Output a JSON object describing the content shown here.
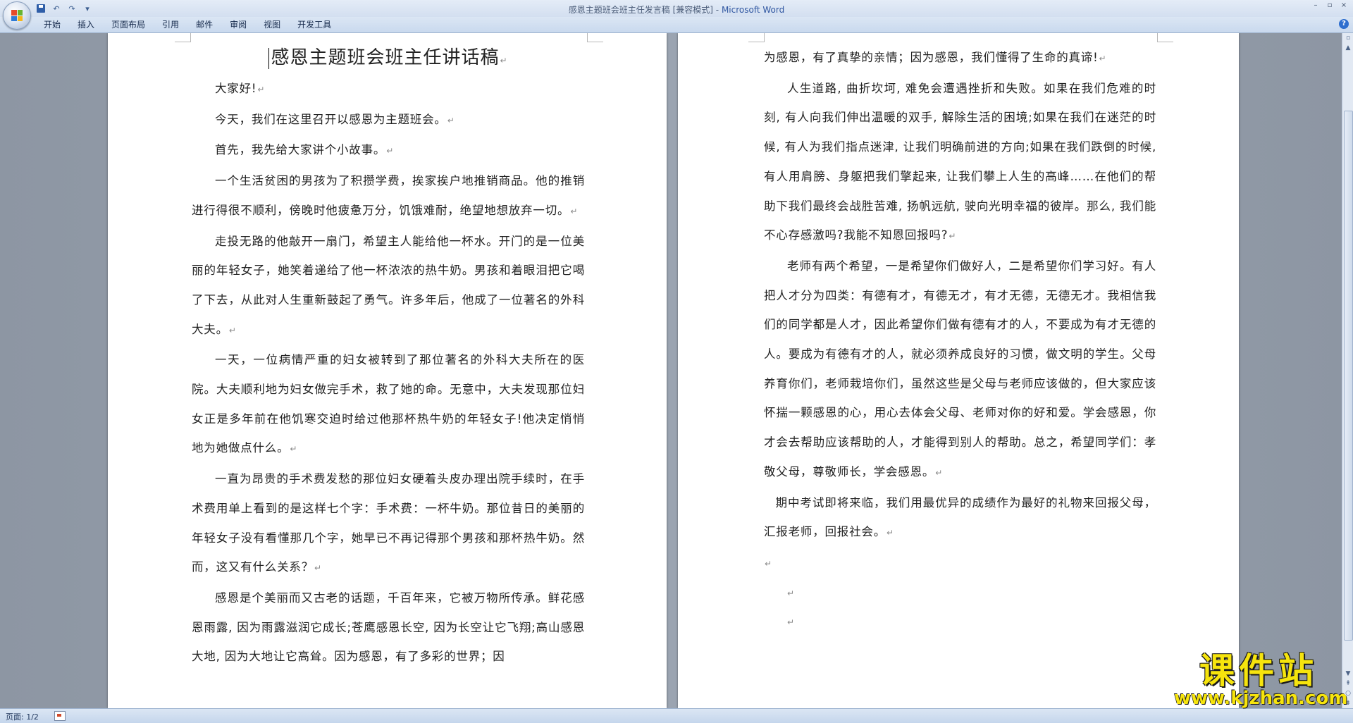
{
  "app": {
    "title_doc": "感恩主题班会班主任发言稿 [兼容模式]",
    "title_sep": " - ",
    "title_app": "Microsoft Word",
    "win_controls": {
      "minimize": "–",
      "restore": "▫",
      "close": "×"
    },
    "qat": {
      "undo": "↶",
      "redo": "↷",
      "more": "▾"
    },
    "help": "?"
  },
  "ribbon": {
    "tabs": [
      {
        "label": "开始"
      },
      {
        "label": "插入"
      },
      {
        "label": "页面布局"
      },
      {
        "label": "引用"
      },
      {
        "label": "邮件"
      },
      {
        "label": "审阅"
      },
      {
        "label": "视图"
      },
      {
        "label": "开发工具"
      }
    ]
  },
  "document": {
    "title": "感恩主题班会班主任讲话稿",
    "pilcrow": "↵",
    "left_page": [
      "大家好!",
      "今天，我们在这里召开以感恩为主题班会。",
      "首先，我先给大家讲个小故事。",
      "一个生活贫困的男孩为了积攒学费，挨家挨户地推销商品。他的推销进行得很不顺利，傍晚时他疲惫万分，饥饿难耐，绝望地想放弃一切。",
      "走投无路的他敲开一扇门，希望主人能给他一杯水。开门的是一位美丽的年轻女子，她笑着递给了他一杯浓浓的热牛奶。男孩和着眼泪把它喝了下去，从此对人生重新鼓起了勇气。许多年后，他成了一位著名的外科大夫。",
      "一天，一位病情严重的妇女被转到了那位著名的外科大夫所在的医院。大夫顺利地为妇女做完手术，救了她的命。无意中，大夫发现那位妇女正是多年前在他饥寒交迫时给过他那杯热牛奶的年轻女子!他决定悄悄地为她做点什么。",
      "一直为昂贵的手术费发愁的那位妇女硬着头皮办理出院手续时，在手术费用单上看到的是这样七个字：手术费：一杯牛奶。那位昔日的美丽的年轻女子没有看懂那几个字，她早已不再记得那个男孩和那杯热牛奶。然而，这又有什么关系？",
      "感恩是个美丽而又古老的话题，千百年来，它被万物所传承。鲜花感恩雨露, 因为雨露滋润它成长;苍鹰感恩长空, 因为长空让它飞翔;高山感恩大地, 因为大地让它高耸。因为感恩，有了多彩的世界；因"
    ],
    "right_page": {
      "continuation": "为感恩，有了真挚的亲情；因为感恩，我们懂得了生命的真谛!",
      "paragraphs": [
        "人生道路, 曲折坎坷, 难免会遭遇挫折和失败。如果在我们危难的时刻, 有人向我们伸出温暖的双手, 解除生活的困境;如果在我们在迷茫的时候, 有人为我们指点迷津, 让我们明确前进的方向;如果在我们跌倒的时候, 有人用肩膀、身躯把我们擎起来, 让我们攀上人生的高峰……在他们的帮助下我们最终会战胜苦难, 扬帆远航, 驶向光明幸福的彼岸。那么, 我们能不心存感激吗?我能不知恩回报吗?",
        "老师有两个希望，一是希望你们做好人，二是希望你们学习好。有人把人才分为四类：有德有才，有德无才，有才无德，无德无才。我相信我们的同学都是人才，因此希望你们做有德有才的人，不要成为有才无德的人。要成为有德有才的人，就必须养成良好的习惯，做文明的学生。父母养育你们，老师栽培你们，虽然这些是父母与老师应该做的，但大家应该怀揣一颗感恩的心，用心去体会父母、老师对你的好和爱。学会感恩，你才会去帮助应该帮助的人，才能得到别人的帮助。总之，希望同学们：孝敬父母，尊敬师长，学会感恩。"
      ],
      "closing": "期中考试即将来临，我们用最优异的成绩作为最好的礼物来回报父母，汇报老师，回报社会。"
    }
  },
  "statusbar": {
    "page_info": "页面: 1/2"
  },
  "watermark": {
    "main": "课件站",
    "url": "www.kjzhan.com"
  }
}
